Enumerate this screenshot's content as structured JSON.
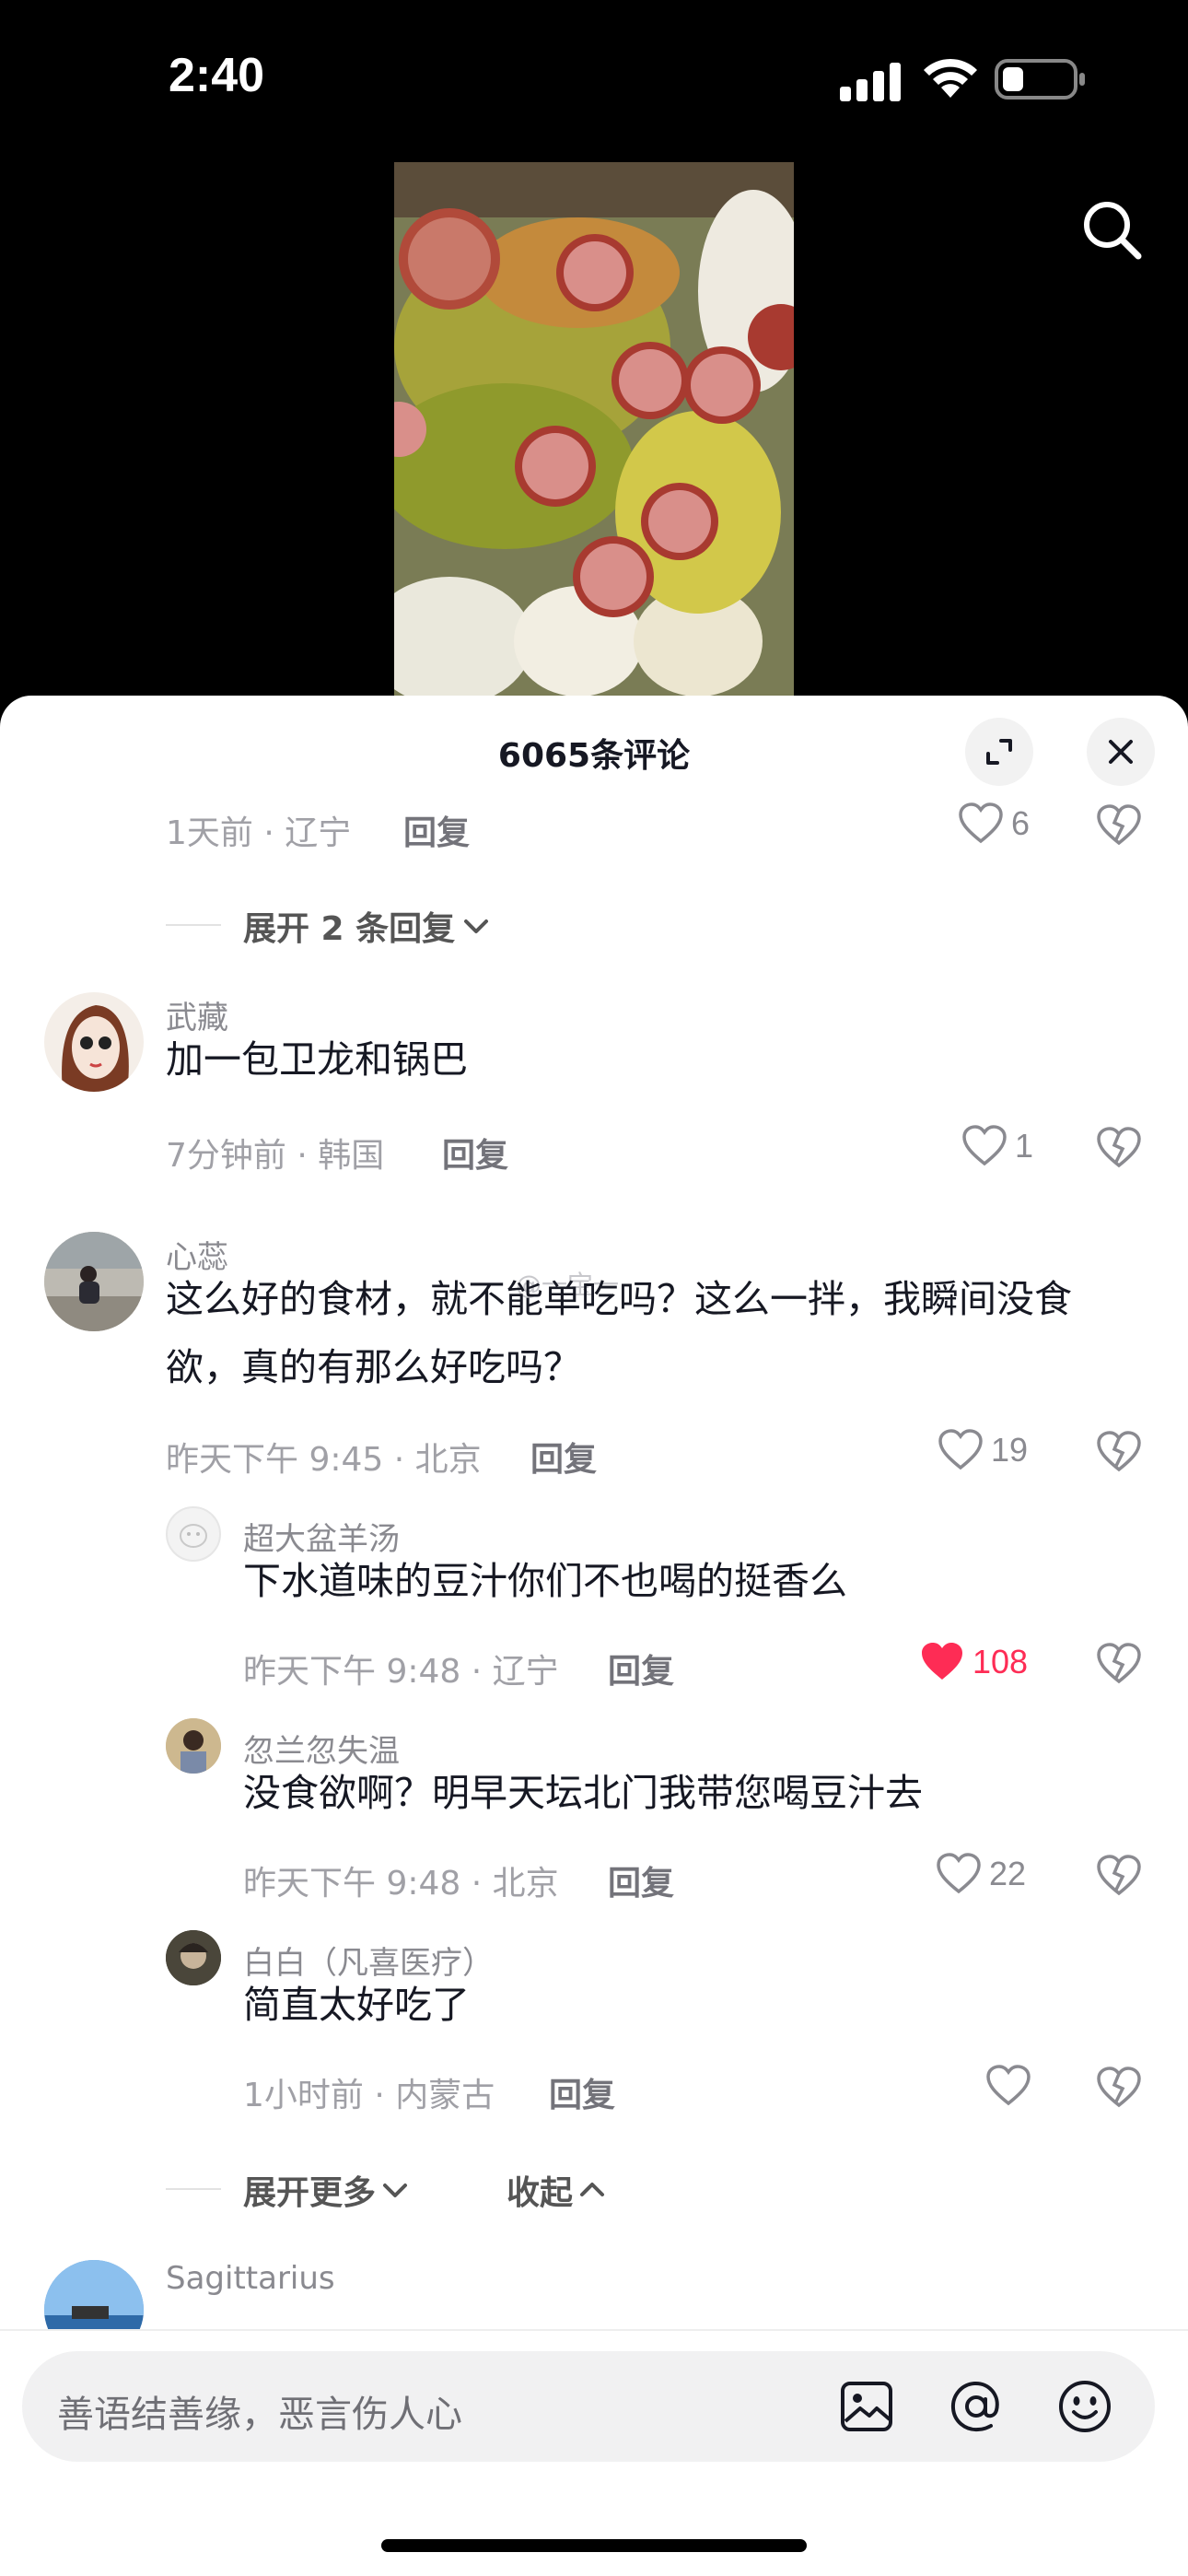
{
  "status": {
    "time": "2:40"
  },
  "header": {
    "title": "6065条评论"
  },
  "comments": {
    "prev": {
      "meta": "1天前 · 辽宁",
      "reply": "回复",
      "likes": "6",
      "expand": "展开 2 条回复"
    },
    "c1": {
      "user": "武藏",
      "text": "加一包卫龙和锅巴",
      "meta": "7分钟前 · 韩国",
      "reply": "回复",
      "likes": "1"
    },
    "c2": {
      "user": "心蕊",
      "text_line1": "这么好的食材，就不能单吃吗？这么一拌，我瞬间没食",
      "text_line2": "欲，真的有那么好吃吗？",
      "watermark": "@一宝一",
      "meta": "昨天下午 9:45 · 北京",
      "reply": "回复",
      "likes": "19",
      "replies": [
        {
          "user": "超大盆羊汤",
          "text": "下水道味的豆汁你们不也喝的挺香么",
          "meta": "昨天下午 9:48 · 辽宁",
          "reply": "回复",
          "likes": "108",
          "liked": true
        },
        {
          "user": "忽兰忽失温",
          "text": "没食欲啊？明早天坛北门我带您喝豆汁去",
          "meta": "昨天下午 9:48 · 北京",
          "reply": "回复",
          "likes": "22",
          "liked": false
        },
        {
          "user": "白白（凡喜医疗）",
          "text": "简直太好吃了",
          "meta": "1小时前 · 内蒙古",
          "reply": "回复",
          "likes": "",
          "liked": false
        }
      ],
      "expand_more": "展开更多",
      "collapse": "收起"
    },
    "c3": {
      "user": "Sagittarius"
    }
  },
  "input": {
    "placeholder": "善语结善缘，恶言伤人心"
  },
  "colors": {
    "like_active": "#fe2c55",
    "meta": "#a0a0a6",
    "text": "#161823"
  }
}
